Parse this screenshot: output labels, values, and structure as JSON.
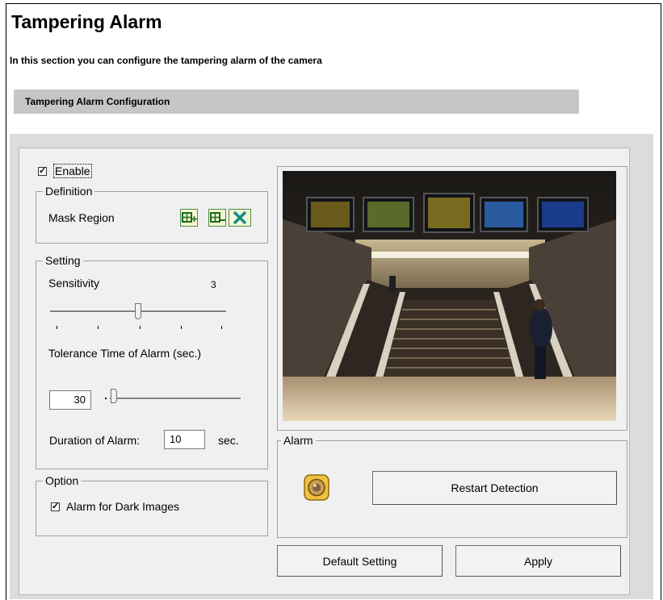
{
  "header": {
    "title": "Tampering Alarm",
    "subtitle": "In this section you can configure the tampering alarm of the camera",
    "section_title": "Tampering Alarm Configuration"
  },
  "enable": {
    "label": "Enable",
    "checked": true
  },
  "definition": {
    "legend": "Definition",
    "mask_label": "Mask Region",
    "mask_buttons": [
      "add-mask-icon",
      "remove-mask-icon",
      "clear-mask-icon"
    ]
  },
  "setting": {
    "legend": "Setting",
    "sensitivity_label": "Sensitivity",
    "sensitivity_value": "3",
    "sensitivity_level_fraction": 0.5,
    "tolerance_label": "Tolerance Time of Alarm (sec.)",
    "tolerance_value": "30",
    "duration_label": "Duration of Alarm:",
    "duration_value": "10",
    "duration_unit": "sec."
  },
  "option": {
    "legend": "Option",
    "dark_images_label": "Alarm for Dark Images",
    "dark_images_checked": true
  },
  "alarm": {
    "legend": "Alarm",
    "restart_label": "Restart Detection",
    "indicator_icon": "alarm-indicator-icon"
  },
  "footer": {
    "default_label": "Default Setting",
    "apply_label": "Apply"
  },
  "colors": {
    "panel_bg": "#dcdcdc",
    "group_bg": "#f0f0f0",
    "section_bar": "#c6c6c6",
    "alarm_icon": "#f0c040"
  }
}
